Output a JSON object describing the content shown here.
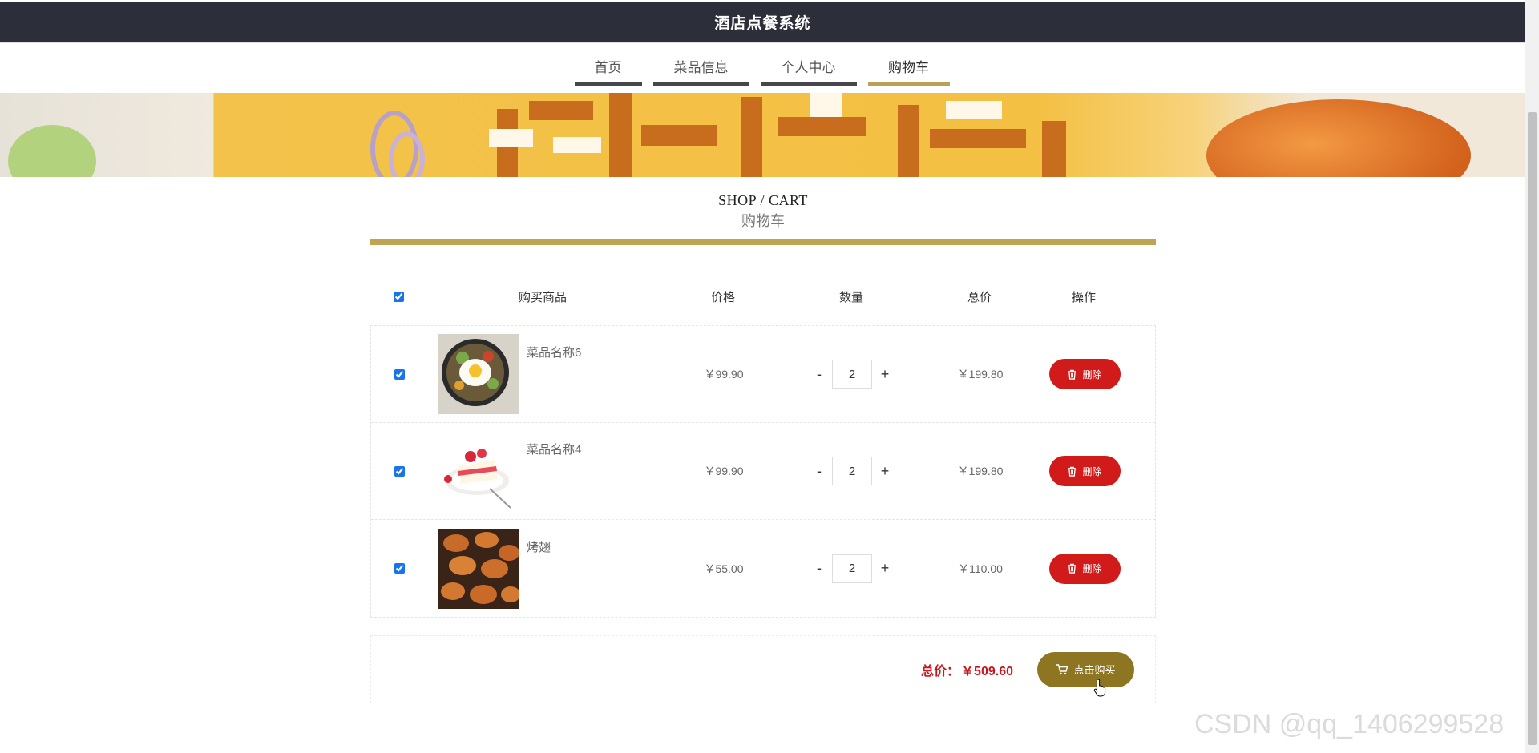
{
  "header": {
    "title": "酒店点餐系统"
  },
  "nav": [
    {
      "label": "首页",
      "active": false
    },
    {
      "label": "菜品信息",
      "active": false
    },
    {
      "label": "个人中心",
      "active": false
    },
    {
      "label": "购物车",
      "active": true
    }
  ],
  "section": {
    "title_en": "SHOP / CART",
    "title_cn": "购物车"
  },
  "table": {
    "headers": {
      "product": "购买商品",
      "price": "价格",
      "qty": "数量",
      "total": "总价",
      "op": "操作"
    },
    "select_all_checked": true,
    "rows": [
      {
        "checked": true,
        "name": "菜品名称6",
        "image": "fried-egg-bibimbap-image",
        "price": "￥99.90",
        "minus": "-",
        "qty": "2",
        "plus": "+",
        "total": "￥199.80",
        "delete_label": "删除"
      },
      {
        "checked": true,
        "name": "菜品名称4",
        "image": "strawberry-cake-image",
        "price": "￥99.90",
        "minus": "-",
        "qty": "2",
        "plus": "+",
        "total": "￥199.80",
        "delete_label": "删除"
      },
      {
        "checked": true,
        "name": "烤翅",
        "image": "grilled-wings-image",
        "price": "￥55.00",
        "minus": "-",
        "qty": "2",
        "plus": "+",
        "total": "￥110.00",
        "delete_label": "删除"
      }
    ]
  },
  "footer": {
    "total_label": "总价：",
    "total_value": "￥509.60",
    "buy_label": "点击购买"
  },
  "watermark": "CSDN @qq_1406299528",
  "colors": {
    "topbar": "#2c2f3a",
    "accent_gold": "#bfa456",
    "delete_red": "#d11a1a",
    "buy_gold": "#8d7521",
    "total_red": "#c8161d"
  }
}
